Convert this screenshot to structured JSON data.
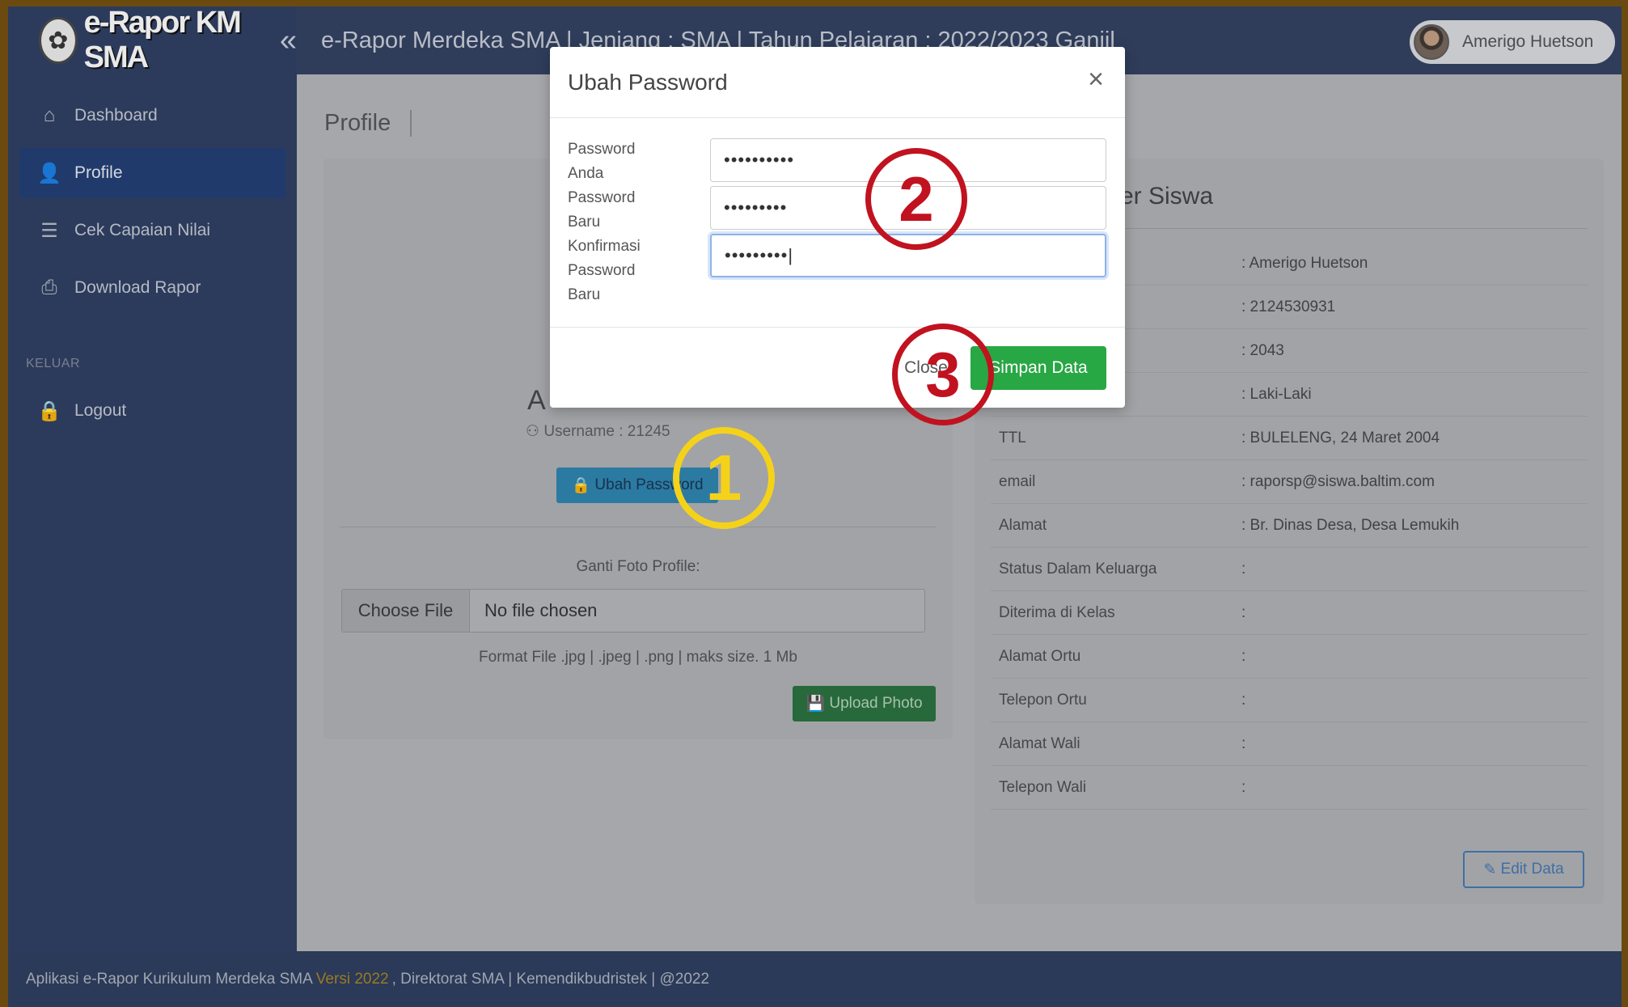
{
  "brand": {
    "name": "e-Rapor KM SMA"
  },
  "topbar": {
    "title": "e-Rapor Merdeka SMA | Jenjang : SMA | Tahun Pelajaran : 2022/2023 Ganjil",
    "user": "Amerigo Huetson"
  },
  "sidebar": {
    "items": [
      {
        "label": "Dashboard",
        "icon": "home-icon"
      },
      {
        "label": "Profile",
        "icon": "user-check-icon"
      },
      {
        "label": "Cek Capaian Nilai",
        "icon": "document-list-icon"
      },
      {
        "label": "Download Rapor",
        "icon": "printer-icon"
      }
    ],
    "section": "KELUAR",
    "logout": {
      "label": "Logout",
      "icon": "lock-icon"
    }
  },
  "page": {
    "title": "Profile"
  },
  "left_card": {
    "name_partial": "A",
    "username": "Username : 21245",
    "ubah_button": "Ubah Password",
    "ganti_label": "Ganti Foto Profile:",
    "file_button": "Choose File",
    "file_status": "No file chosen",
    "format": "Format File .jpg | .jpeg | .png | maks size. 1 Mb",
    "upload_button": "Upload Photo"
  },
  "right_card": {
    "title": "ser Siswa",
    "rows": [
      {
        "label": "",
        "value": ": Amerigo Huetson"
      },
      {
        "label": "",
        "value": ": 2124530931"
      },
      {
        "label": "",
        "value": ": 2043"
      },
      {
        "label": "",
        "value": ": Laki-Laki"
      },
      {
        "label": "TTL",
        "value": ": BULELENG, 24 Maret 2004"
      },
      {
        "label": "email",
        "value": ": raporsp@siswa.baltim.com"
      },
      {
        "label": "Alamat",
        "value": ": Br. Dinas Desa, Desa Lemukih"
      },
      {
        "label": "Status Dalam Keluarga",
        "value": ":"
      },
      {
        "label": "Diterima di Kelas",
        "value": ":"
      },
      {
        "label": "Alamat Ortu",
        "value": ":"
      },
      {
        "label": "Telepon Ortu",
        "value": ":"
      },
      {
        "label": "Alamat Wali",
        "value": ":"
      },
      {
        "label": "Telepon Wali",
        "value": ":"
      }
    ],
    "edit_button": "Edit Data"
  },
  "footer": {
    "text1": "Aplikasi e-Rapor Kurikulum Merdeka SMA",
    "version": "Versi 2022",
    "text2": ", Direktorat SMA | Kemendikbudristek | @2022"
  },
  "modal": {
    "title": "Ubah Password",
    "fields": [
      {
        "label": "Password Anda",
        "value": "••••••••••"
      },
      {
        "label": "Password Baru",
        "value": "•••••••••"
      },
      {
        "label": "Konfirmasi Password Baru",
        "value": "•••••••••|"
      }
    ],
    "close_button": "Close",
    "save_button": "Simpan Data"
  },
  "steps": [
    "1",
    "2",
    "3"
  ],
  "colors": {
    "sidebar": "#2c3b5c",
    "save": "#28a745",
    "step1": "#f5d21a",
    "step23": "#c1121f"
  }
}
